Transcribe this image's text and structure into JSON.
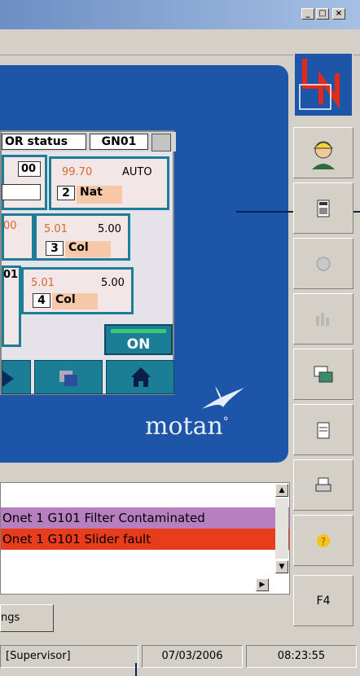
{
  "window": {
    "min_label": "_",
    "max_label": "□",
    "close_label": "×"
  },
  "hmi": {
    "header_status": "OR status",
    "header_id": "GN01",
    "box_top_value": "00",
    "station_nat": {
      "setpoint": "99.70",
      "mode": "AUTO",
      "number": "2",
      "material": "Nat"
    },
    "station_col3": {
      "actual": "5.01",
      "setpoint": "5.00",
      "number": "3",
      "material": "Col"
    },
    "station_col4": {
      "actual": "5.01",
      "setpoint": "5.00",
      "number": "4",
      "material": "Col"
    },
    "left_partial_1": "00",
    "left_partial_2": "01",
    "on_label": "ON"
  },
  "brand": {
    "name": "motan",
    "mark": "°"
  },
  "sidebar": {
    "f4_label": "F4"
  },
  "alarms": [
    {
      "text": "Onet 1 G101  Filter Contaminated",
      "color": "#b77fc0"
    },
    {
      "text": "Onet 1 G101  Slider fault",
      "color": "#e83c1d"
    }
  ],
  "bottom_button_label": "ngs",
  "status": {
    "user": "[Supervisor]",
    "date": "07/03/2006",
    "time": "08:23:55"
  },
  "colors": {
    "panel_blue": "#1d55a8",
    "teal": "#1b7e96",
    "accent_red": "#e32a1a"
  }
}
